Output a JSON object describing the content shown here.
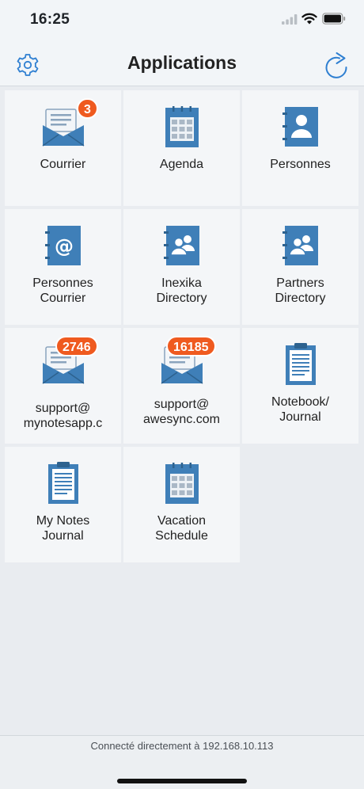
{
  "status_bar": {
    "time": "16:25"
  },
  "nav": {
    "title": "Applications",
    "settings_icon": "gear-icon",
    "refresh_icon": "refresh-icon"
  },
  "colors": {
    "accent": "#2f7fd1",
    "badge": "#ef5a1f",
    "icon_blue": "#3f7fb8"
  },
  "apps": [
    {
      "label": "Courrier",
      "icon": "mail-icon",
      "badge": "3"
    },
    {
      "label": "Agenda",
      "icon": "calendar-icon",
      "badge": ""
    },
    {
      "label": "Personnes",
      "icon": "contact-book-icon",
      "badge": ""
    },
    {
      "label": "Personnes\nCourrier",
      "icon": "email-contacts-icon",
      "badge": ""
    },
    {
      "label": "Inexika\nDirectory",
      "icon": "directory-icon",
      "badge": ""
    },
    {
      "label": "Partners\nDirectory",
      "icon": "directory-icon",
      "badge": ""
    },
    {
      "label": "support@\nmynotesapp.c",
      "icon": "mail-icon",
      "badge": "2746"
    },
    {
      "label": "support@\nawesync.com",
      "icon": "mail-icon",
      "badge": "16185"
    },
    {
      "label": "Notebook/\nJournal",
      "icon": "notebook-icon",
      "badge": ""
    },
    {
      "label": "My Notes\nJournal",
      "icon": "notebook-icon",
      "badge": ""
    },
    {
      "label": "Vacation\nSchedule",
      "icon": "calendar-icon",
      "badge": ""
    }
  ],
  "footer": {
    "connection_status": "Connecté directement à 192.168.10.113"
  }
}
